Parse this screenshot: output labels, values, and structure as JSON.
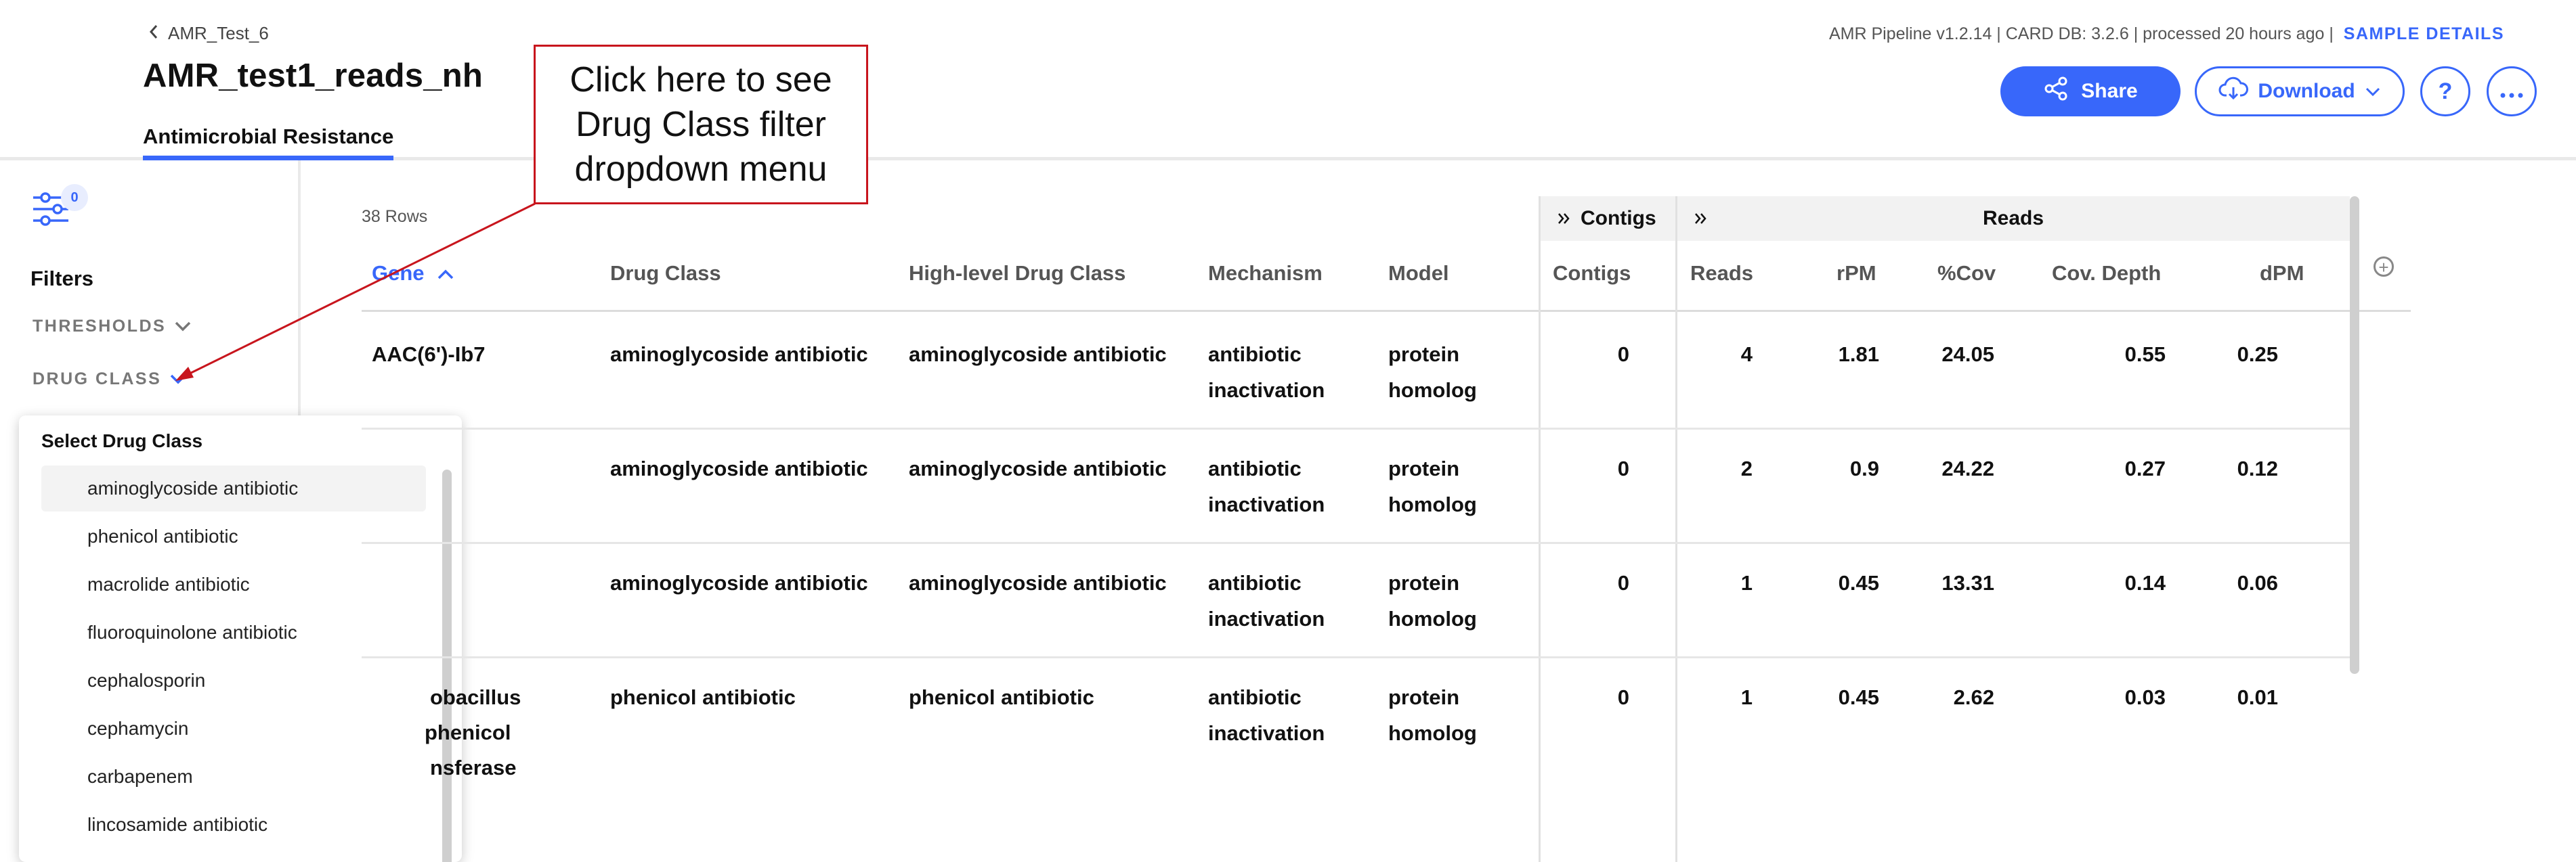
{
  "header": {
    "back_label": "AMR_Test_6",
    "sample_title": "AMR_test1_reads_nh",
    "tab": "Antimicrobial Resistance",
    "pipeline_info": "AMR Pipeline v1.2.14 | CARD DB: 3.2.6 | processed 20 hours ago |",
    "sample_details": "SAMPLE DETAILS",
    "share_label": "Share",
    "download_label": "Download",
    "help_label": "?",
    "more_label": "···"
  },
  "sidebar": {
    "filter_count": "0",
    "filters_title": "Filters",
    "thresholds_label": "THRESHOLDS",
    "drug_class_label": "DRUG CLASS"
  },
  "dropdown": {
    "title": "Select Drug Class",
    "items": [
      "aminoglycoside antibiotic",
      "phenicol antibiotic",
      "macrolide antibiotic",
      "fluoroquinolone antibiotic",
      "cephalosporin",
      "cephamycin",
      "carbapenem",
      "lincosamide antibiotic"
    ]
  },
  "annotation": {
    "text": "Click here to see Drug Class filter dropdown menu"
  },
  "table": {
    "rows_count": "38 Rows",
    "group_contigs": "Contigs",
    "group_reads": "Reads",
    "headers": {
      "gene": "Gene",
      "drug_class": "Drug Class",
      "high_level": "High-level Drug Class",
      "mechanism": "Mechanism",
      "model": "Model",
      "contigs": "Contigs",
      "reads": "Reads",
      "rpm": "rPM",
      "cov": "%Cov",
      "depth": "Cov. Depth",
      "dpm": "dPM"
    },
    "rows": [
      {
        "gene": [
          "AAC(6')-Ib7"
        ],
        "drug_class": "aminoglycoside antibiotic",
        "high_level": "aminoglycoside antibiotic",
        "mechanism": [
          "antibiotic",
          "inactivation"
        ],
        "model": [
          "protein",
          "homolog"
        ],
        "contigs": "0",
        "reads": "4",
        "rpm": "1.81",
        "cov": "24.05",
        "depth": "0.55",
        "dpm": "0.25"
      },
      {
        "gene": [],
        "drug_class": "aminoglycoside antibiotic",
        "high_level": "aminoglycoside antibiotic",
        "mechanism": [
          "antibiotic",
          "inactivation"
        ],
        "model": [
          "protein",
          "homolog"
        ],
        "contigs": "0",
        "reads": "2",
        "rpm": "0.9",
        "cov": "24.22",
        "depth": "0.27",
        "dpm": "0.12"
      },
      {
        "gene": [],
        "drug_class": "aminoglycoside antibiotic",
        "high_level": "aminoglycoside antibiotic",
        "mechanism": [
          "antibiotic",
          "inactivation"
        ],
        "model": [
          "protein",
          "homolog"
        ],
        "contigs": "0",
        "reads": "1",
        "rpm": "0.45",
        "cov": "13.31",
        "depth": "0.14",
        "dpm": "0.06"
      },
      {
        "gene": [
          "obacillus",
          "phenicol",
          "nsferase"
        ],
        "drug_class": "phenicol antibiotic",
        "high_level": "phenicol antibiotic",
        "mechanism": [
          "antibiotic",
          "inactivation"
        ],
        "model": [
          "protein",
          "homolog"
        ],
        "contigs": "0",
        "reads": "1",
        "rpm": "0.45",
        "cov": "2.62",
        "depth": "0.03",
        "dpm": "0.01"
      }
    ]
  },
  "colors": {
    "accent": "#3867fa",
    "callout_border": "#c8151d"
  }
}
